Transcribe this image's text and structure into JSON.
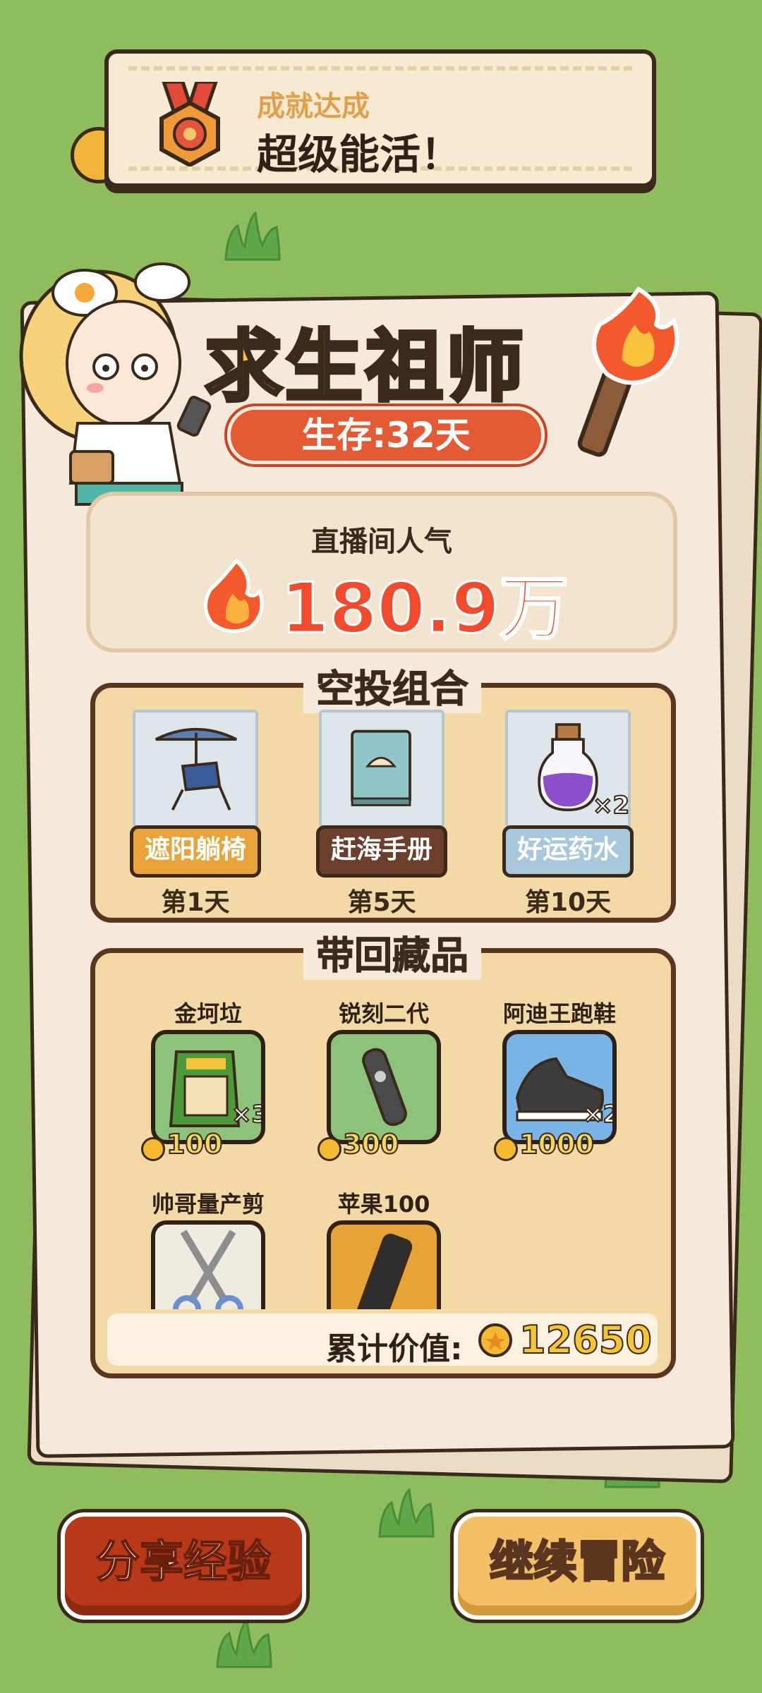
{
  "achievement": {
    "subtitle": "成就达成",
    "title": "超级能活！"
  },
  "header": {
    "title": "求生祖师",
    "survival": "生存:32天"
  },
  "popularity": {
    "label": "直播间人气",
    "value": "180.9万"
  },
  "airdrop": {
    "title": "空投组合",
    "items": [
      {
        "label": "遮阳躺椅",
        "day": "第1天",
        "color": "#e8a43a",
        "icon": "sun-lounger-icon"
      },
      {
        "label": "赶海手册",
        "day": "第5天",
        "color": "#6b3f2b",
        "icon": "book-icon"
      },
      {
        "label": "好运药水",
        "day": "第10天",
        "color": "#a7c7dc",
        "icon": "potion-icon",
        "count": "×2"
      }
    ]
  },
  "collection": {
    "title": "带回藏品",
    "items": [
      {
        "name": "金坷垃",
        "price": "100",
        "count": "×3",
        "icon": "fertilizer-bag-icon",
        "bg": "#8cc27a"
      },
      {
        "name": "锐刻二代",
        "price": "300",
        "icon": "vape-icon",
        "bg": "#8cc27a"
      },
      {
        "name": "阿迪王跑鞋",
        "price": "1000",
        "count": "×2",
        "icon": "sneaker-icon",
        "bg": "#7ab3e6"
      },
      {
        "name": "帅哥量产剪",
        "icon": "scissors-icon",
        "bg": "#f0ebe0"
      },
      {
        "name": "苹果100",
        "icon": "phone-icon",
        "bg": "#e6a336"
      }
    ],
    "total_label": "累计价值:",
    "total_value": "12650"
  },
  "buttons": {
    "share": "分享经验",
    "continue": "继续冒险"
  }
}
